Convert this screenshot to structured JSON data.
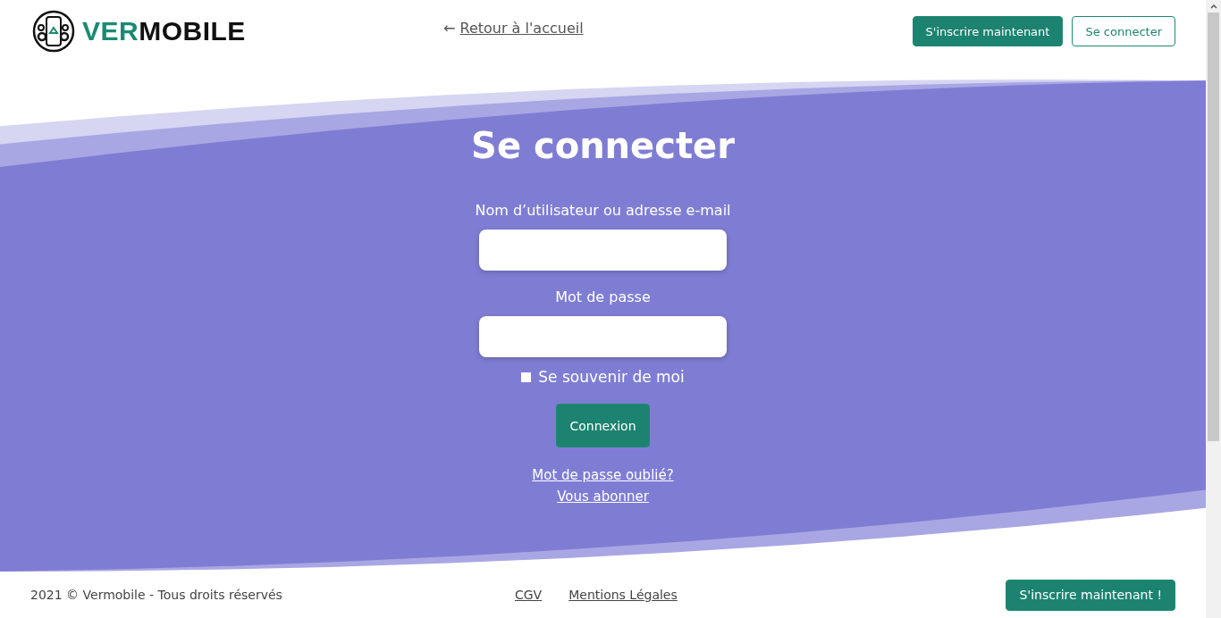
{
  "header": {
    "logo": {
      "accent": "VER",
      "rest": "MOBILE"
    },
    "back_link": {
      "arrow": "←",
      "label": "Retour à l'accueil"
    },
    "buttons": [
      {
        "label": "S'inscrire maintenant",
        "kind": "primary"
      },
      {
        "label": "Se connecter",
        "kind": "outline"
      }
    ]
  },
  "login": {
    "title": "Se connecter",
    "fields": [
      {
        "label": "Nom d’utilisateur ou adresse e-mail"
      },
      {
        "label": "Mot de passe"
      }
    ],
    "remember": {
      "label": "Se souvenir de moi",
      "checked": false
    },
    "submit": "Connexion",
    "links": [
      "Mot de passe oublié?",
      "Vous abonner"
    ]
  },
  "footer": {
    "copyright": "2021 © Vermobile - Tous droits réservés",
    "links": [
      "CGV",
      "Mentions Légales"
    ],
    "button": "S'inscrire maintenant !"
  }
}
